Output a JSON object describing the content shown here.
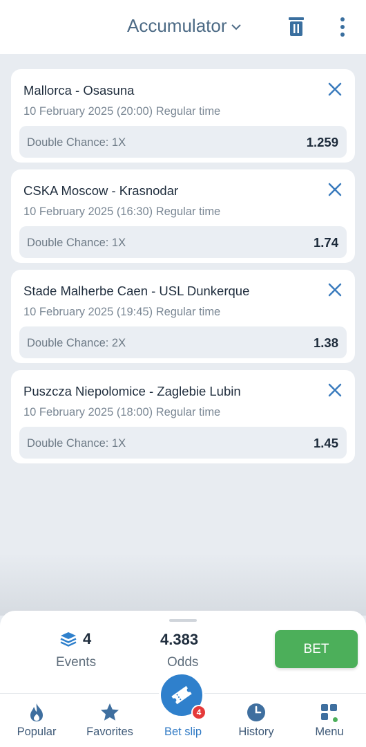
{
  "header": {
    "title": "Accumulator",
    "trash_icon": "trash-icon",
    "more_icon": "more-vertical-icon"
  },
  "bets": [
    {
      "match": "Mallorca - Osasuna",
      "date": "10 February 2025 (20:00) Regular time",
      "market": "Double Chance: 1X",
      "odds": "1.259"
    },
    {
      "match": "CSKA Moscow - Krasnodar",
      "date": "10 February 2025 (16:30) Regular time",
      "market": "Double Chance: 1X",
      "odds": "1.74"
    },
    {
      "match": "Stade Malherbe Caen - USL Dunkerque",
      "date": "10 February 2025 (19:45) Regular time",
      "market": "Double Chance: 2X",
      "odds": "1.38"
    },
    {
      "match": "Puszcza Niepolomice - Zaglebie Lubin",
      "date": "10 February 2025 (18:00) Regular time",
      "market": "Double Chance: 1X",
      "odds": "1.45"
    }
  ],
  "summary": {
    "events_count": "4",
    "events_label": "Events",
    "total_odds": "4.383",
    "odds_label": "Odds",
    "bet_label": "BET"
  },
  "nav": {
    "items": [
      {
        "label": "Popular",
        "icon": "flame-icon"
      },
      {
        "label": "Favorites",
        "icon": "star-icon"
      },
      {
        "label": "Bet slip",
        "icon": "ticket-icon",
        "badge": "4",
        "active": true
      },
      {
        "label": "History",
        "icon": "clock-icon"
      },
      {
        "label": "Menu",
        "icon": "grid-icon"
      }
    ]
  },
  "colors": {
    "accent": "#2f80cc",
    "bet_button": "#4caf5a",
    "badge": "#e53a3a",
    "background": "#e8ecf1"
  }
}
